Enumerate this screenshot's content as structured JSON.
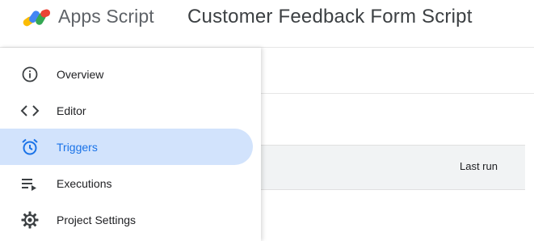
{
  "header": {
    "brand": "Apps Script",
    "project_title": "Customer Feedback Form Script"
  },
  "table": {
    "column_last_run": "Last run"
  },
  "sidebar": {
    "items": [
      {
        "label": "Overview",
        "icon": "info-icon",
        "active": false
      },
      {
        "label": "Editor",
        "icon": "code-icon",
        "active": false
      },
      {
        "label": "Triggers",
        "icon": "alarm-clock-icon",
        "active": true
      },
      {
        "label": "Executions",
        "icon": "executions-list-icon",
        "active": false
      },
      {
        "label": "Project Settings",
        "icon": "gear-icon",
        "active": false
      }
    ]
  },
  "colors": {
    "active_bg": "#d2e3fc",
    "active_text": "#1a73e8",
    "logo_blue": "#4285f4",
    "logo_red": "#ea4335",
    "logo_yellow": "#fbbc04",
    "logo_green": "#34a853"
  }
}
